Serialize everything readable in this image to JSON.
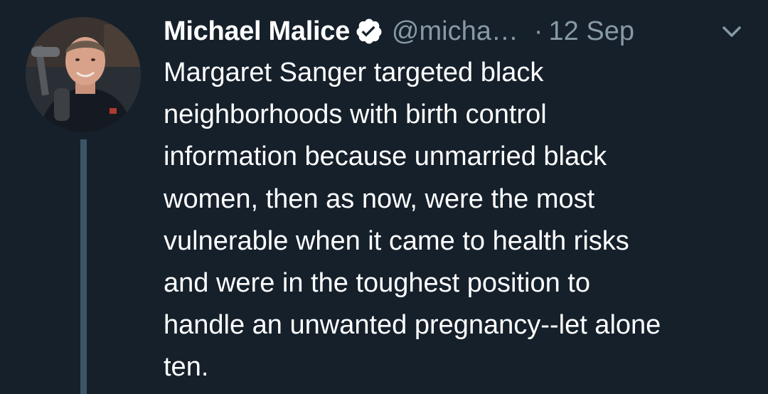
{
  "author": {
    "display_name": "Michael Malice",
    "handle": "@micha…",
    "verified": true
  },
  "meta": {
    "separator": "·",
    "timestamp": "12 Sep"
  },
  "icons": {
    "verified": "verified-badge-icon",
    "menu": "chevron-down-icon",
    "avatar": "profile-photo"
  },
  "tweet": {
    "lines": [
      "Margaret Sanger targeted black",
      "neighborhoods with birth control",
      "information because unmarried black",
      "women, then as now, were the most",
      "vulnerable when it came to health risks",
      "and were in the toughest position to",
      "handle an unwanted pregnancy--let alone",
      "ten."
    ]
  },
  "colors": {
    "background": "#15202b",
    "text_primary": "#ffffff",
    "text_secondary": "#8899a6",
    "thread_line": "#3d5466"
  }
}
